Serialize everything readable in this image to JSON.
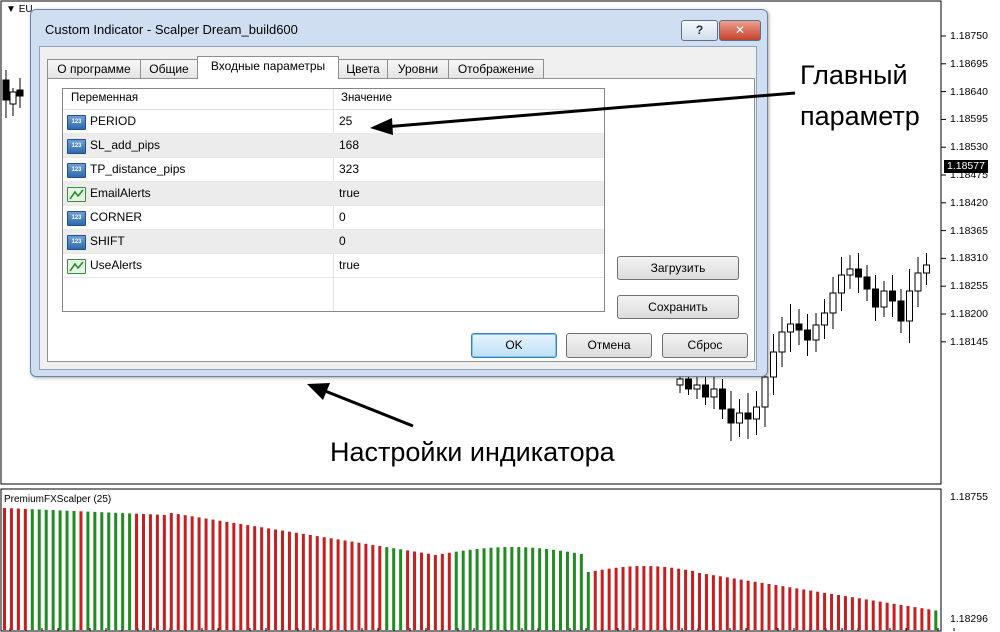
{
  "chart": {
    "symbol": "EU",
    "current_price": "1.18577",
    "price_labels": [
      "1.18750",
      "1.18695",
      "1.18640",
      "1.18595",
      "1.18530",
      "1.18475",
      "1.18420",
      "1.18365",
      "1.18310",
      "1.18255",
      "1.18200",
      "1.18145"
    ],
    "indicator_label": "PremiumFXScalper (25)",
    "indicator_scale": [
      "1.18755",
      "1.18296"
    ],
    "colors": {
      "up_bar": "#c81e1e",
      "down_bar": "#1e8c1e"
    }
  },
  "dialog": {
    "title": "Custom Indicator - Scalper Dream_build600",
    "help_button": "?",
    "close_button": "✕",
    "tabs": [
      {
        "label": "О программе"
      },
      {
        "label": "Общие"
      },
      {
        "label": "Входные параметры"
      },
      {
        "label": "Цвета"
      },
      {
        "label": "Уровни"
      },
      {
        "label": "Отображение"
      }
    ],
    "active_tab": "Входные параметры",
    "table": {
      "col_variable": "Переменная",
      "col_value": "Значение",
      "rows": [
        {
          "icon": "integer-icon",
          "icon_text": "123",
          "name": "PERIOD",
          "value": "25"
        },
        {
          "icon": "integer-icon",
          "icon_text": "123",
          "name": "SL_add_pips",
          "value": "168"
        },
        {
          "icon": "integer-icon",
          "icon_text": "123",
          "name": "TP_distance_pips",
          "value": "323"
        },
        {
          "icon": "boolean-icon",
          "icon_text": "",
          "name": "EmailAlerts",
          "value": "true"
        },
        {
          "icon": "integer-icon",
          "icon_text": "123",
          "name": "CORNER",
          "value": "0"
        },
        {
          "icon": "integer-icon",
          "icon_text": "123",
          "name": "SHIFT",
          "value": "0"
        },
        {
          "icon": "boolean-icon",
          "icon_text": "",
          "name": "UseAlerts",
          "value": "true"
        }
      ]
    },
    "load_button": "Загрузить",
    "save_button": "Сохранить",
    "ok_button": "OK",
    "cancel_button": "Отмена",
    "reset_button": "Сброс"
  },
  "annotations": {
    "main_param_line1": "Главный",
    "main_param_line2": "параметр",
    "indicator_settings": "Настройки индикатора"
  }
}
